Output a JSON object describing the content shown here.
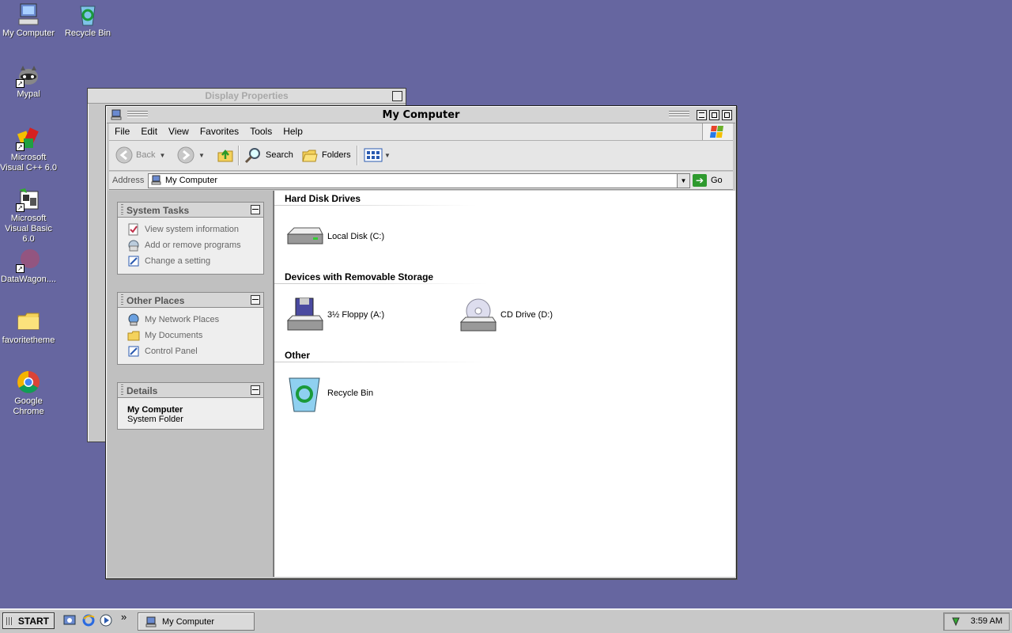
{
  "desktop": {
    "icons": [
      {
        "label": "My Computer",
        "icon": "my-computer-icon"
      },
      {
        "label": "Recycle Bin",
        "icon": "recycle-bin-icon"
      },
      {
        "label": "Mypal",
        "icon": "mypal-raccoon-icon"
      },
      {
        "label": "Microsoft Visual C++ 6.0",
        "icon": "visual-cpp-icon"
      },
      {
        "label": "Microsoft Visual Basic 6.0",
        "icon": "visual-basic-icon"
      },
      {
        "label": "DataWagon....",
        "icon": "datawagon-icon"
      },
      {
        "label": "favoritetheme",
        "icon": "folder-icon"
      },
      {
        "label": "Google Chrome",
        "icon": "chrome-icon"
      }
    ]
  },
  "bg_window": {
    "title": "Display Properties"
  },
  "window": {
    "title": "My Computer",
    "menu": [
      "File",
      "Edit",
      "View",
      "Favorites",
      "Tools",
      "Help"
    ],
    "toolbar": {
      "back": "Back",
      "search": "Search",
      "folders": "Folders"
    },
    "address": {
      "label": "Address",
      "value": "My Computer",
      "go": "Go"
    }
  },
  "sidebar": {
    "system_tasks": {
      "title": "System Tasks",
      "items": [
        "View system information",
        "Add or remove programs",
        "Change a setting"
      ]
    },
    "other_places": {
      "title": "Other Places",
      "items": [
        "My Network Places",
        "My Documents",
        "Control Panel"
      ]
    },
    "details": {
      "title": "Details",
      "name": "My Computer",
      "type": "System Folder"
    }
  },
  "content": {
    "groups": [
      {
        "title": "Hard Disk Drives",
        "items": [
          "Local Disk (C:)"
        ]
      },
      {
        "title": "Devices with Removable Storage",
        "items": [
          "3½ Floppy (A:)",
          "CD Drive (D:)"
        ]
      },
      {
        "title": "Other",
        "items": [
          "Recycle Bin"
        ]
      }
    ]
  },
  "taskbar": {
    "start": "START",
    "task": "My Computer",
    "chevron": "»",
    "clock": "3:59 AM"
  },
  "colors": {
    "desktop": "#6666a0",
    "go_green": "#2e9a2e"
  }
}
